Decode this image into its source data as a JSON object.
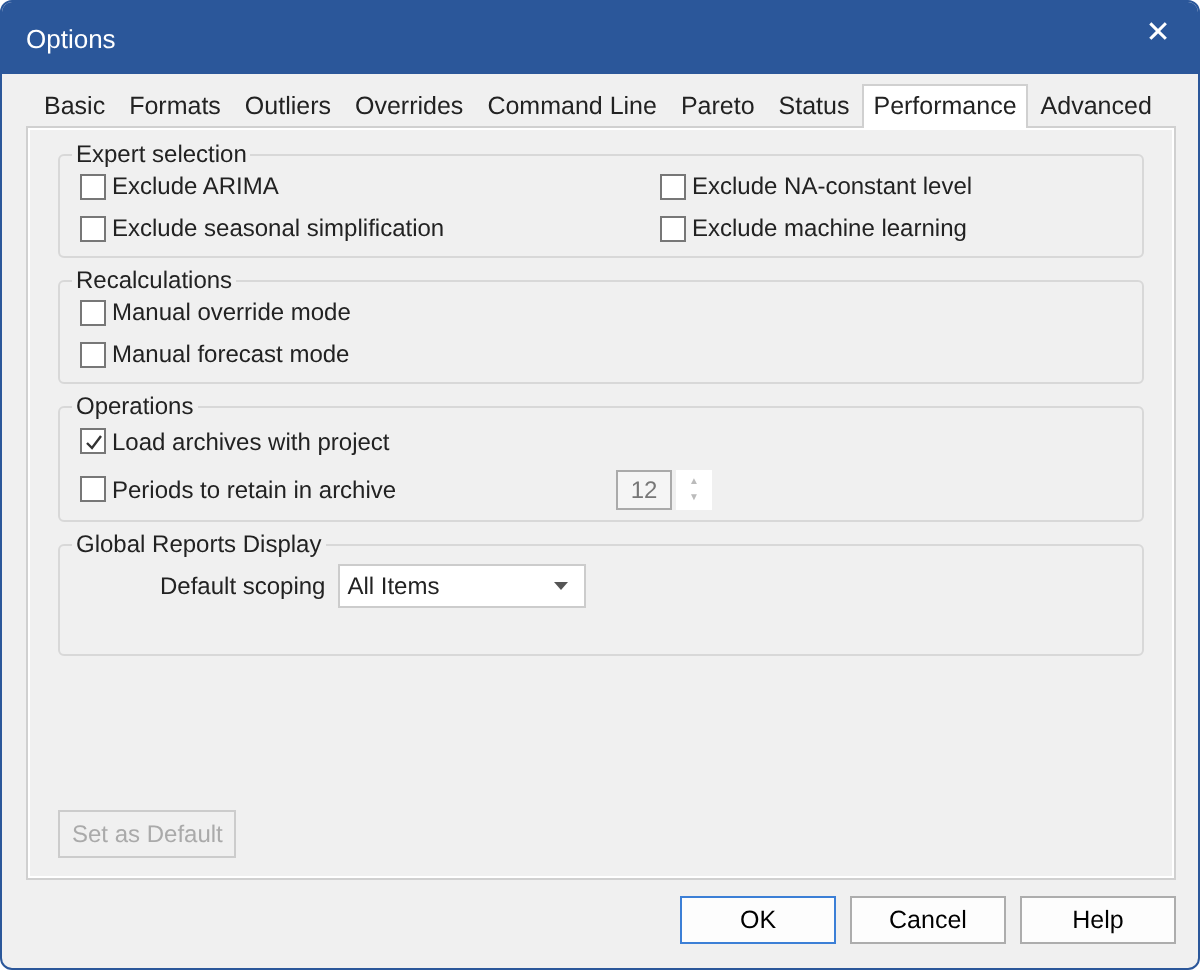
{
  "window": {
    "title": "Options",
    "close": "✕"
  },
  "tabs": [
    {
      "label": "Basic",
      "selected": false
    },
    {
      "label": "Formats",
      "selected": false
    },
    {
      "label": "Outliers",
      "selected": false
    },
    {
      "label": "Overrides",
      "selected": false
    },
    {
      "label": "Command Line",
      "selected": false
    },
    {
      "label": "Pareto",
      "selected": false
    },
    {
      "label": "Status",
      "selected": false
    },
    {
      "label": "Performance",
      "selected": true
    },
    {
      "label": "Advanced",
      "selected": false
    }
  ],
  "expert_selection": {
    "title": "Expert selection",
    "options": [
      {
        "label": "Exclude ARIMA",
        "checked": false
      },
      {
        "label": "Exclude NA-constant level",
        "checked": false
      },
      {
        "label": "Exclude seasonal simplification",
        "checked": false
      },
      {
        "label": "Exclude machine learning",
        "checked": false
      }
    ]
  },
  "recalculations": {
    "title": "Recalculations",
    "options": [
      {
        "label": "Manual override mode",
        "checked": false
      },
      {
        "label": "Manual forecast mode",
        "checked": false
      }
    ]
  },
  "operations": {
    "title": "Operations",
    "options": [
      {
        "label": "Load archives with project",
        "checked": true
      },
      {
        "label": "Periods to retain in archive",
        "checked": false,
        "spinner": {
          "value": "12",
          "disabled": true,
          "up": "▲",
          "down": "▼"
        }
      }
    ]
  },
  "global_reports_display": {
    "title": "Global Reports Display",
    "label": "Default scoping",
    "dropdown": {
      "value": "All Items"
    }
  },
  "set_default_button": {
    "label": "Set as Default",
    "disabled": true
  },
  "buttons": [
    {
      "label": "OK",
      "default": true
    },
    {
      "label": "Cancel",
      "default": false
    },
    {
      "label": "Help",
      "default": false
    }
  ]
}
